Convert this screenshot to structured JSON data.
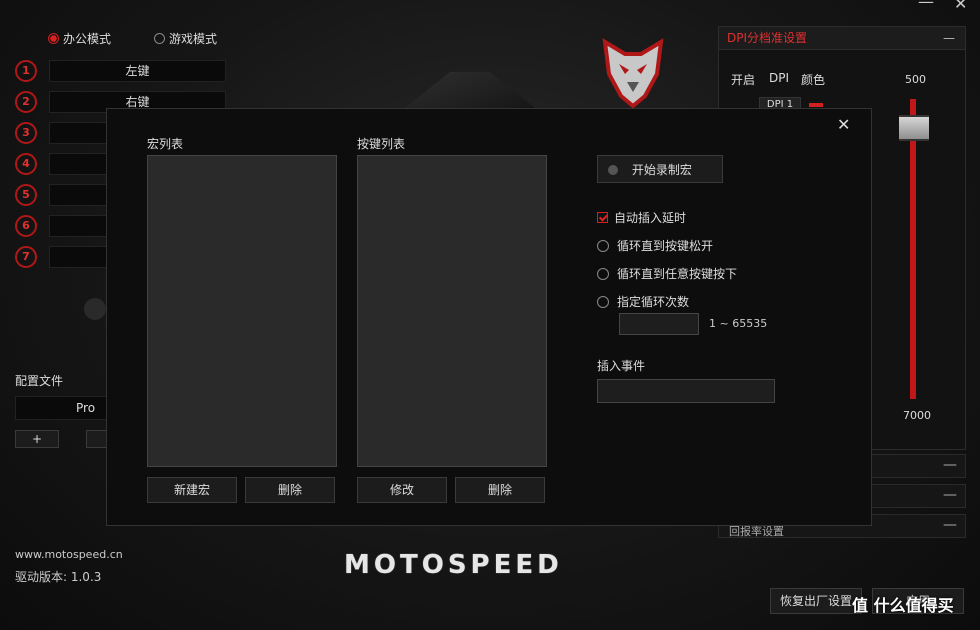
{
  "window": {
    "minimize": "—",
    "close": "✕"
  },
  "mode": {
    "office": "办公模式",
    "game": "游戏模式"
  },
  "buttons": [
    {
      "num": "1",
      "label": "左键"
    },
    {
      "num": "2",
      "label": "右键"
    },
    {
      "num": "3",
      "label": ""
    },
    {
      "num": "4",
      "label": ""
    },
    {
      "num": "5",
      "label": ""
    },
    {
      "num": "6",
      "label": ""
    },
    {
      "num": "7",
      "label": ""
    }
  ],
  "profile": {
    "title": "配置文件",
    "current": "Pro",
    "add": "+",
    "extra": "",
    "website": "www.motospeed.cn",
    "version": "驱动版本: 1.0.3"
  },
  "brand": "MOTOSPEED",
  "dpi": {
    "title": "DPI分档准设置",
    "cols": [
      "开启",
      "DPI",
      "颜色"
    ],
    "row1": "DPI 1",
    "max": "500",
    "min": "7000",
    "collapse": "—",
    "bottom_item": "回报率设置"
  },
  "footer": {
    "reset": "恢复出厂设置",
    "apply": "应用"
  },
  "watermark": "值 什么值得买",
  "modal": {
    "close": "✕",
    "macro_list": "宏列表",
    "key_list": "按键列表",
    "record": "开始录制宏",
    "auto_delay": "自动插入延时",
    "loop_release": "循环直到按键松开",
    "loop_any": "循环直到任意按键按下",
    "loop_count": "指定循环次数",
    "count_range": "1 ~ 65535",
    "count_value": "",
    "insert_event": "插入事件",
    "insert_value": "",
    "new_macro": "新建宏",
    "delete": "删除",
    "modify": "修改",
    "delete2": "删除"
  }
}
